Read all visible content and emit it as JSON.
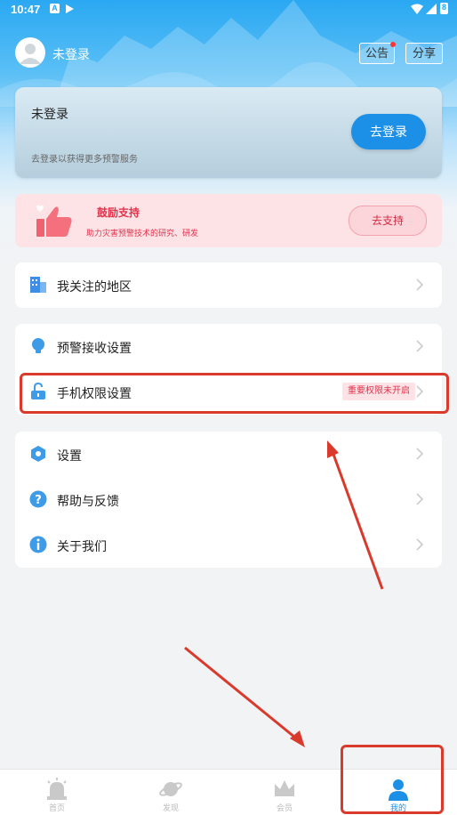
{
  "status_bar": {
    "time": "10:47",
    "icon_a": "A",
    "battery_level": "8"
  },
  "header": {
    "username": "未登录",
    "notice_button": "公告",
    "share_button": "分享"
  },
  "login_card": {
    "title": "未登录",
    "subtitle": "去登录以获得更多预警服务",
    "button": "去登录"
  },
  "support_card": {
    "title": "鼓励支持",
    "subtitle": "助力灾害预警技术的研究、研发",
    "button": "去支持"
  },
  "menu": {
    "group1": [
      {
        "label": "我关注的地区",
        "icon": "buildings-icon"
      }
    ],
    "group2": [
      {
        "label": "预警接收设置",
        "icon": "lightbulb-icon"
      },
      {
        "label": "手机权限设置",
        "icon": "unlock-icon",
        "tag": "重要权限未开启"
      }
    ],
    "group3": [
      {
        "label": "设置",
        "icon": "hexagon-settings-icon"
      },
      {
        "label": "帮助与反馈",
        "icon": "question-icon"
      },
      {
        "label": "关于我们",
        "icon": "info-icon"
      }
    ]
  },
  "tabs": [
    {
      "label": "首页",
      "icon": "alarm-icon",
      "active": false
    },
    {
      "label": "发现",
      "icon": "planet-icon",
      "active": false
    },
    {
      "label": "会员",
      "icon": "crown-icon",
      "active": false
    },
    {
      "label": "我的",
      "icon": "person-icon",
      "active": true
    }
  ],
  "colors": {
    "accent": "#1c8fe6",
    "warning": "#e0334d",
    "annotation": "#d93a2c"
  }
}
